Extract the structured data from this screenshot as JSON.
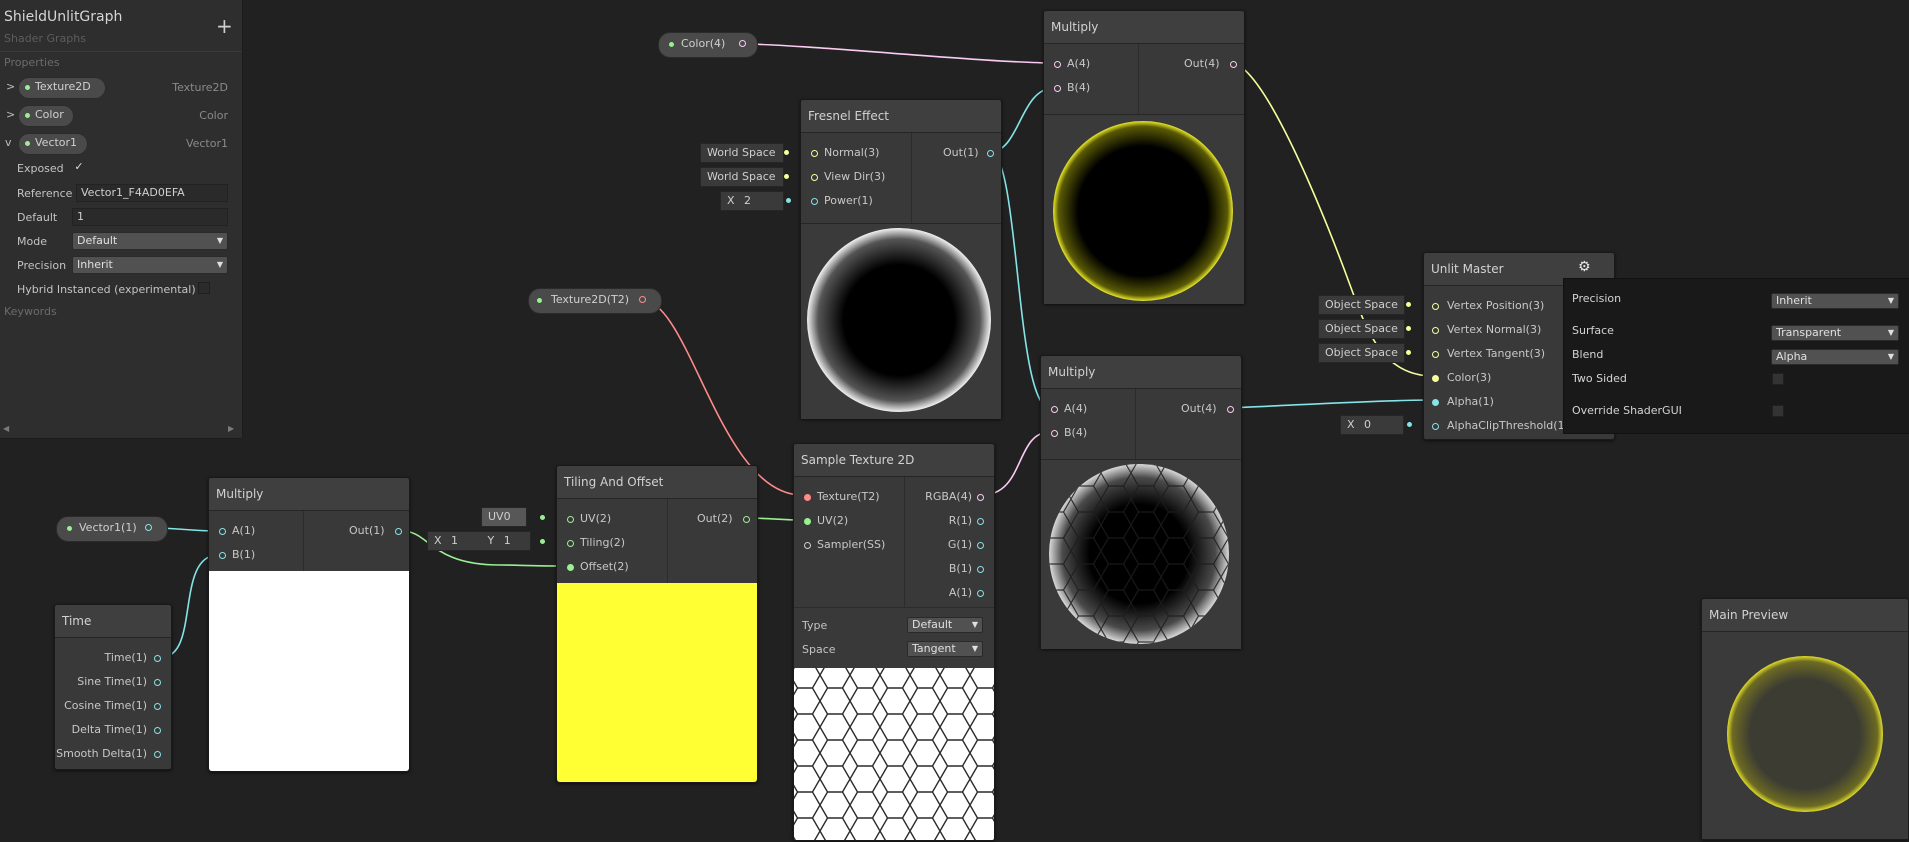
{
  "blackboard": {
    "title": "ShieldUnlitGraph",
    "subtitle": "Shader Graphs",
    "add_symbol": "+",
    "properties_header": "Properties",
    "properties": [
      {
        "name": "Texture2D",
        "type": "Texture2D",
        "expander": ">"
      },
      {
        "name": "Color",
        "type": "Color",
        "expander": ">"
      },
      {
        "name": "Vector1",
        "type": "Vector1",
        "expander": "v"
      }
    ],
    "vector1_settings": {
      "exposed_label": "Exposed",
      "exposed_check": "✓",
      "reference_label": "Reference",
      "reference_value": "Vector1_F4AD0EFA",
      "default_label": "Default",
      "default_value": "1",
      "mode_label": "Mode",
      "mode_value": "Default",
      "precision_label": "Precision",
      "precision_value": "Inherit",
      "hybrid_label": "Hybrid Instanced (experimental)"
    },
    "keywords_header": "Keywords"
  },
  "property_nodes": {
    "color": "Color(4)",
    "texture": "Texture2D(T2)",
    "vector1": "Vector1(1)"
  },
  "multiply_top": {
    "title": "Multiply",
    "in_a": "A(4)",
    "in_b": "B(4)",
    "out": "Out(4)"
  },
  "multiply_mid": {
    "title": "Multiply",
    "in_a": "A(4)",
    "in_b": "B(4)",
    "out": "Out(4)"
  },
  "multiply_left": {
    "title": "Multiply",
    "in_a": "A(1)",
    "in_b": "B(1)",
    "out": "Out(1)"
  },
  "fresnel": {
    "title": "Fresnel Effect",
    "inputs": [
      "Normal(3)",
      "View Dir(3)",
      "Power(1)"
    ],
    "out": "Out(1)",
    "normal_chip": "World Space",
    "viewdir_chip": "World Space",
    "power_axis": "X",
    "power_value": "2"
  },
  "tiling": {
    "title": "Tiling And Offset",
    "inputs": [
      "UV(2)",
      "Tiling(2)",
      "Offset(2)"
    ],
    "out": "Out(2)",
    "uv_chip": "UV0",
    "tiling_x_label": "X",
    "tiling_x_value": "1",
    "tiling_y_label": "Y",
    "tiling_y_value": "1"
  },
  "sample_tex": {
    "title": "Sample Texture 2D",
    "inputs": [
      "Texture(T2)",
      "UV(2)",
      "Sampler(SS)"
    ],
    "outputs": [
      "RGBA(4)",
      "R(1)",
      "G(1)",
      "B(1)",
      "A(1)"
    ],
    "type_label": "Type",
    "type_value": "Default",
    "space_label": "Space",
    "space_value": "Tangent"
  },
  "time": {
    "title": "Time",
    "outputs": [
      "Time(1)",
      "Sine Time(1)",
      "Cosine Time(1)",
      "Delta Time(1)",
      "Smooth Delta(1)"
    ]
  },
  "unlit_master": {
    "title": "Unlit Master",
    "inputs": [
      "Vertex Position(3)",
      "Vertex Normal(3)",
      "Vertex Tangent(3)",
      "Color(3)",
      "Alpha(1)",
      "AlphaClipThreshold(1)"
    ],
    "space_chips": [
      "Object Space",
      "Object Space",
      "Object Space"
    ],
    "clip_axis": "X",
    "clip_value": "0"
  },
  "settings_popup": {
    "precision_label": "Precision",
    "precision_value": "Inherit",
    "surface_label": "Surface",
    "surface_value": "Transparent",
    "blend_label": "Blend",
    "blend_value": "Alpha",
    "two_sided_label": "Two Sided",
    "override_label": "Override ShaderGUI"
  },
  "main_preview": {
    "title": "Main Preview"
  },
  "colors": {
    "canvas": "#212121",
    "node_bg": "#393939",
    "port_vec1": "#84e4e7",
    "port_vec2": "#9aef92",
    "port_vec3": "#f6ff9a",
    "port_vec4": "#fbcbf4",
    "port_tex": "#ff8b8b",
    "preview_yellow": "#ffff33"
  }
}
